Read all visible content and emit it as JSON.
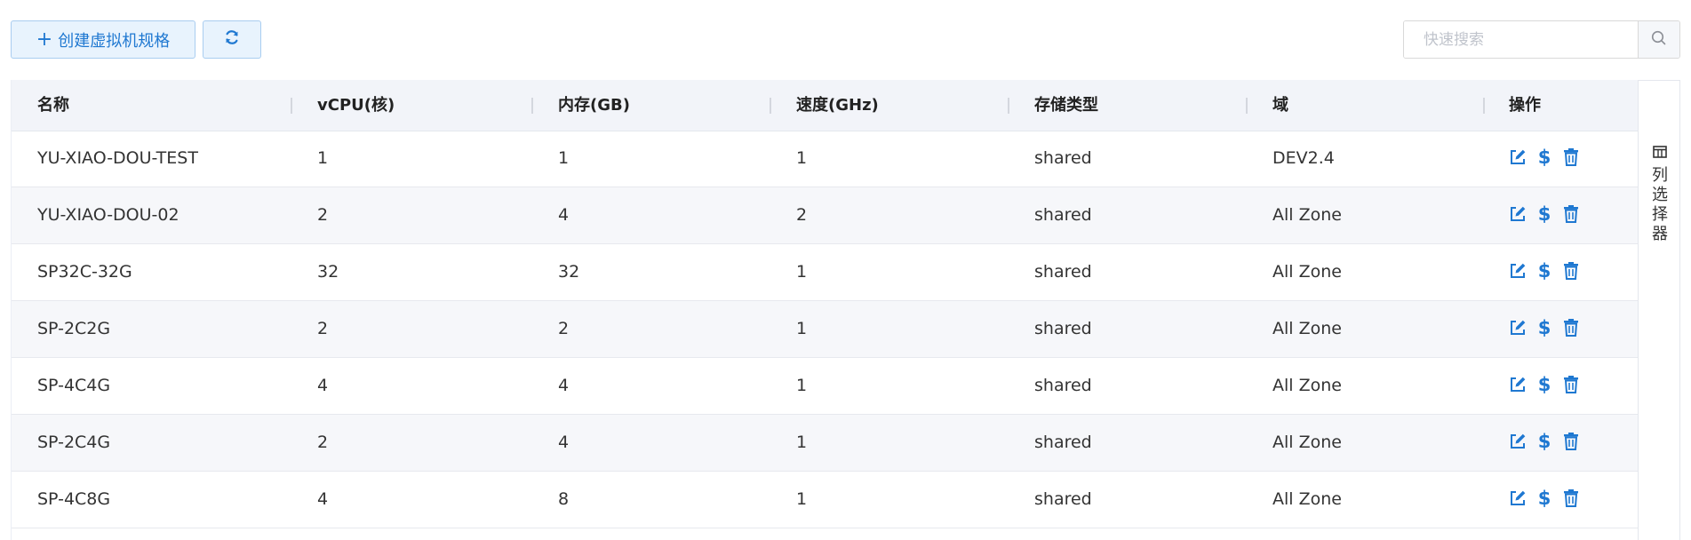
{
  "toolbar": {
    "create_label": "创建虚拟机规格",
    "plus_icon": "plus-icon",
    "refresh_icon": "refresh-icon"
  },
  "search": {
    "placeholder": "快速搜索",
    "value": "",
    "icon": "search-icon"
  },
  "table": {
    "columns": [
      "名称",
      "vCPU(核)",
      "内存(GB)",
      "速度(GHz)",
      "存储类型",
      "域",
      "操作"
    ],
    "rows": [
      {
        "name": "YU-XIAO-DOU-TEST",
        "vcpu": "1",
        "memory": "1",
        "speed": "1",
        "storage": "shared",
        "zone": "DEV2.4"
      },
      {
        "name": "YU-XIAO-DOU-02",
        "vcpu": "2",
        "memory": "4",
        "speed": "2",
        "storage": "shared",
        "zone": "All Zone"
      },
      {
        "name": "SP32C-32G",
        "vcpu": "32",
        "memory": "32",
        "speed": "1",
        "storage": "shared",
        "zone": "All Zone"
      },
      {
        "name": "SP-2C2G",
        "vcpu": "2",
        "memory": "2",
        "speed": "1",
        "storage": "shared",
        "zone": "All Zone"
      },
      {
        "name": "SP-4C4G",
        "vcpu": "4",
        "memory": "4",
        "speed": "1",
        "storage": "shared",
        "zone": "All Zone"
      },
      {
        "name": "SP-2C4G",
        "vcpu": "2",
        "memory": "4",
        "speed": "1",
        "storage": "shared",
        "zone": "All Zone"
      },
      {
        "name": "SP-4C8G",
        "vcpu": "4",
        "memory": "8",
        "speed": "1",
        "storage": "shared",
        "zone": "All Zone"
      }
    ],
    "row_actions": [
      "edit-icon",
      "price-icon",
      "delete-icon"
    ]
  },
  "column_selector": {
    "label": "列选择器",
    "icon": "columns-icon"
  },
  "colors": {
    "accent": "#1f78d1",
    "header_bg": "#f2f4f9",
    "alt_row_bg": "#f6f7fa"
  }
}
